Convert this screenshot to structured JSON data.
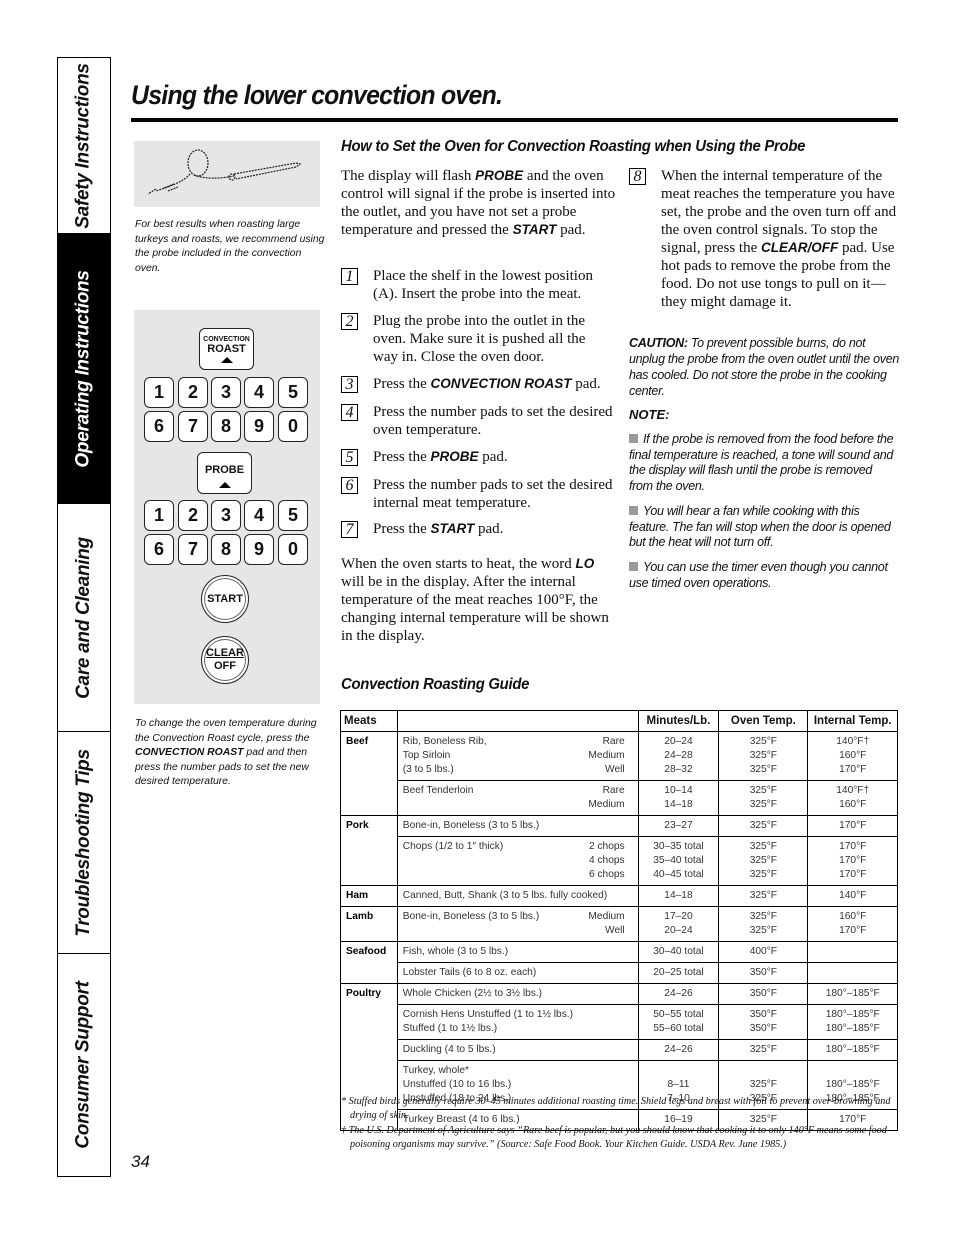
{
  "side_tabs": [
    {
      "label": "Safety Instructions",
      "active": false
    },
    {
      "label": "Operating Instructions",
      "active": true
    },
    {
      "label": "Care and Cleaning",
      "active": false
    },
    {
      "label": "Troubleshooting Tips",
      "active": false
    },
    {
      "label": "Consumer Support",
      "active": false
    }
  ],
  "title": "Using the lower convection oven.",
  "left": {
    "illustration_icon": "meat-probe-icon",
    "probe_caption": "For best results when roasting large turkeys and roasts, we recommend using the probe included in the convection oven.",
    "panel": {
      "convection_roast_small": "CONVECTION",
      "convection_roast_big": "ROAST",
      "probe": "PROBE",
      "start": "START",
      "clear_top": "CLEAR",
      "clear_bottom": "OFF",
      "keypad_1": [
        "1",
        "2",
        "3",
        "4",
        "5",
        "6",
        "7",
        "8",
        "9",
        "0"
      ],
      "keypad_2": [
        "1",
        "2",
        "3",
        "4",
        "5",
        "6",
        "7",
        "8",
        "9",
        "0"
      ]
    },
    "change_caption_pre": "To change the oven temperature during the Convection Roast cycle, press the ",
    "change_caption_kw": "CONVECTION ROAST",
    "change_caption_post": " pad and then press the number pads to set the new desired temperature."
  },
  "section_heading": "How to Set the Oven for Convection Roasting when Using the Probe",
  "intro": {
    "t1": "The display will flash ",
    "k1": "PROBE",
    "t2": " and the oven control will signal if the probe is inserted into the outlet, and you have not set a probe temperature and pressed the ",
    "k2": "START",
    "t3": " pad."
  },
  "steps": [
    {
      "num": "1",
      "pre": "Place the shelf in the lowest position (A). Insert the probe into the meat.",
      "kw": "",
      "post": ""
    },
    {
      "num": "2",
      "pre": "Plug the probe into the outlet in the oven. Make sure it is pushed all the way in. Close the oven door.",
      "kw": "",
      "post": ""
    },
    {
      "num": "3",
      "pre": "Press the ",
      "kw": "CONVECTION ROAST",
      "post": " pad."
    },
    {
      "num": "4",
      "pre": "Press the number pads to set the desired oven temperature.",
      "kw": "",
      "post": ""
    },
    {
      "num": "5",
      "pre": "Press the ",
      "kw": "PROBE",
      "post": " pad."
    },
    {
      "num": "6",
      "pre": "Press the number pads to set the desired internal meat temperature.",
      "kw": "",
      "post": ""
    },
    {
      "num": "7",
      "pre": "Press the ",
      "kw": "START",
      "post": " pad."
    },
    {
      "num": "8",
      "pre": "When the internal temperature of the meat reaches the temperature you have set, the probe and the oven turn off and the oven control signals. To stop the signal, press the ",
      "kw": "CLEAR/OFF",
      "post": " pad. Use hot pads to remove the probe from the food. Do not use tongs to pull on it—they might damage it."
    }
  ],
  "heat_para": {
    "t1": "When the oven starts to heat, the word ",
    "k1": "LO",
    "t2": " will be in the display. After the internal temperature of the meat reaches 100°F, the changing internal temperature will be shown in the display."
  },
  "caution": {
    "label": "CAUTION:",
    "text": " To prevent possible burns, do not unplug the probe from the oven outlet until the oven has cooled. Do not store the probe in the cooking center."
  },
  "note": {
    "label": "NOTE:",
    "items": [
      "If the probe is removed from the food before the final temperature is reached, a tone will sound and the display will flash until the probe is removed from the oven.",
      "You will hear a fan while cooking with this feature. The fan will stop when the door is opened but the heat will not turn off.",
      "You can use the timer even though you cannot use timed oven operations."
    ]
  },
  "guide": {
    "heading": "Convection Roasting Guide",
    "headers": [
      "Meats",
      "",
      "Minutes/Lb.",
      "Oven Temp.",
      "Internal Temp."
    ],
    "rows": [
      {
        "cat": "Beef",
        "desc": [
          "Rib, Boneless Rib,",
          "Top Sirloin",
          "(3 to 5 lbs.)"
        ],
        "done": [
          "Rare",
          "Medium",
          "Well"
        ],
        "mins": [
          "20–24",
          "24–28",
          "28–32"
        ],
        "oven": [
          "325°F",
          "325°F",
          "325°F"
        ],
        "internal": [
          "140°F†",
          "160°F",
          "170°F"
        ]
      },
      {
        "cat": "",
        "desc": [
          "Beef Tenderloin",
          ""
        ],
        "done": [
          "Rare",
          "Medium"
        ],
        "mins": [
          "10–14",
          "14–18"
        ],
        "oven": [
          "325°F",
          "325°F"
        ],
        "internal": [
          "140°F†",
          "160°F"
        ]
      },
      {
        "cat": "Pork",
        "desc": [
          "Bone-in, Boneless (3 to 5 lbs.)"
        ],
        "done": [
          ""
        ],
        "mins": [
          "23–27"
        ],
        "oven": [
          "325°F"
        ],
        "internal": [
          "170°F"
        ]
      },
      {
        "cat": "",
        "desc": [
          "Chops (1/2 to 1″ thick)",
          "",
          ""
        ],
        "done": [
          "2 chops",
          "4 chops",
          "6 chops"
        ],
        "mins": [
          "30–35 total",
          "35–40 total",
          "40–45 total"
        ],
        "oven": [
          "325°F",
          "325°F",
          "325°F"
        ],
        "internal": [
          "170°F",
          "170°F",
          "170°F"
        ]
      },
      {
        "cat": "Ham",
        "desc": [
          "Canned, Butt, Shank (3 to 5 lbs. fully cooked)"
        ],
        "done": [
          ""
        ],
        "mins": [
          "14–18"
        ],
        "oven": [
          "325°F"
        ],
        "internal": [
          "140°F"
        ]
      },
      {
        "cat": "Lamb",
        "desc": [
          "Bone-in, Boneless (3 to 5 lbs.)",
          ""
        ],
        "done": [
          "Medium",
          "Well"
        ],
        "mins": [
          "17–20",
          "20–24"
        ],
        "oven": [
          "325°F",
          "325°F"
        ],
        "internal": [
          "160°F",
          "170°F"
        ]
      },
      {
        "cat": "Seafood",
        "desc": [
          "Fish, whole (3 to 5 lbs.)"
        ],
        "done": [
          ""
        ],
        "mins": [
          "30–40 total"
        ],
        "oven": [
          "400°F"
        ],
        "internal": [
          ""
        ]
      },
      {
        "cat": "",
        "desc": [
          "Lobster Tails (6 to 8 oz. each)"
        ],
        "done": [
          ""
        ],
        "mins": [
          "20–25 total"
        ],
        "oven": [
          "350°F"
        ],
        "internal": [
          ""
        ]
      },
      {
        "cat": "Poultry",
        "desc": [
          "Whole Chicken (2½ to 3½ lbs.)"
        ],
        "done": [
          ""
        ],
        "mins": [
          "24–26"
        ],
        "oven": [
          "350°F"
        ],
        "internal": [
          "180°–185°F"
        ]
      },
      {
        "cat": "",
        "desc": [
          "Cornish Hens Unstuffed (1 to 1½ lbs.)",
          "Stuffed (1 to 1½ lbs.)"
        ],
        "done": [
          "",
          ""
        ],
        "mins": [
          "50–55 total",
          "55–60 total"
        ],
        "oven": [
          "350°F",
          "350°F"
        ],
        "internal": [
          "180°–185°F",
          "180°–185°F"
        ]
      },
      {
        "cat": "",
        "desc": [
          "Duckling (4 to 5 lbs.)"
        ],
        "done": [
          ""
        ],
        "mins": [
          "24–26"
        ],
        "oven": [
          "325°F"
        ],
        "internal": [
          "180°–185°F"
        ]
      },
      {
        "cat": "",
        "desc": [
          "Turkey, whole*",
          "Unstuffed (10 to 16 lbs.)",
          "Unstuffed (18 to 24 lbs.)"
        ],
        "done": [
          "",
          "",
          ""
        ],
        "mins": [
          "",
          "8–11",
          "7–10"
        ],
        "oven": [
          "",
          "325°F",
          "325°F"
        ],
        "internal": [
          "",
          "180°–185°F",
          "180°–185°F"
        ]
      },
      {
        "cat": "",
        "desc": [
          "Turkey Breast (4 to 6 lbs.)"
        ],
        "done": [
          ""
        ],
        "mins": [
          "16–19"
        ],
        "oven": [
          "325°F"
        ],
        "internal": [
          "170°F"
        ]
      }
    ],
    "footnotes": [
      "* Stuffed birds generally require 30–45 minutes additional roasting time. Shield legs and breast with foil to prevent over-browning and drying of skin.",
      "† The U.S. Department of Agriculture says “Rare beef is popular, but you should know that cooking it to only 140°F means some food poisoning organisms may survive.” (Source: Safe Food Book. Your Kitchen Guide. USDA Rev. June 1985.)"
    ]
  },
  "page_number": "34"
}
